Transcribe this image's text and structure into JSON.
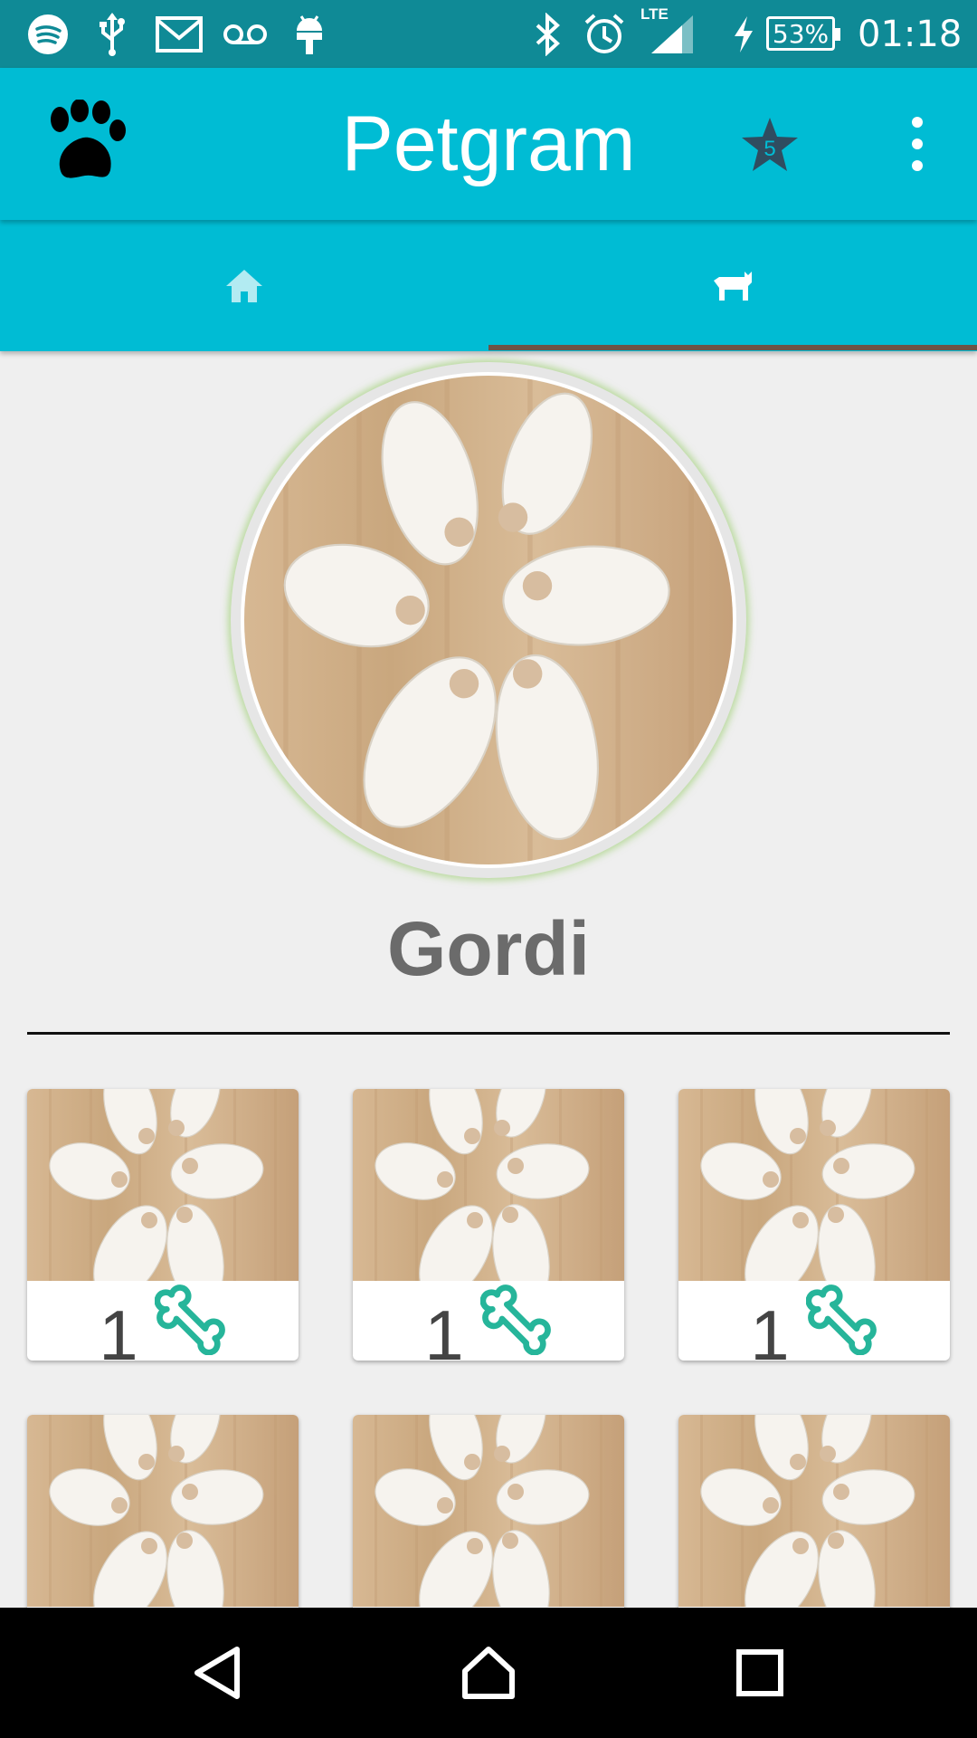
{
  "status_bar": {
    "battery": "53%",
    "time": "01:18",
    "network": "LTE",
    "icons": [
      "spotify-icon",
      "usb-icon",
      "gmail-icon",
      "voicemail-icon",
      "android-icon",
      "bluetooth-icon",
      "alarm-icon",
      "signal-icon",
      "charging-icon"
    ]
  },
  "toolbar": {
    "title": "Petgram",
    "favorites_count": "5",
    "colors": {
      "primary": "#00bcd4",
      "status": "#0f8a96",
      "indicator": "#6d5346",
      "bone": "#26b59a"
    }
  },
  "tabs": [
    {
      "name": "home",
      "icon": "home-icon",
      "selected": false
    },
    {
      "name": "profile",
      "icon": "dog-icon",
      "selected": true
    }
  ],
  "profile": {
    "name": "Gordi"
  },
  "photos": [
    {
      "likes": "1"
    },
    {
      "likes": "1"
    },
    {
      "likes": "1"
    },
    {
      "likes": ""
    },
    {
      "likes": ""
    },
    {
      "likes": ""
    }
  ],
  "navbar": [
    "back-icon",
    "home-icon",
    "recents-icon"
  ]
}
